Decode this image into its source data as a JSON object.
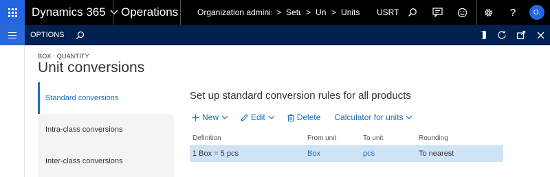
{
  "nav": {
    "app_name": "Dynamics 365",
    "workspace": "Operations",
    "breadcrumbs": [
      "Organization administ",
      "Setu",
      "Uni",
      "Units"
    ],
    "company": "USRT",
    "avatar_initials": "O."
  },
  "actionbar": {
    "options_label": "OPTIONS"
  },
  "page": {
    "caption": "BOX : QUANTITY",
    "title": "Unit conversions"
  },
  "tabs": [
    {
      "label": "Standard conversions",
      "active": true
    },
    {
      "label": "Intra-class conversions",
      "active": false
    },
    {
      "label": "Inter-class conversions",
      "active": false
    }
  ],
  "content": {
    "section_title": "Set up standard conversion rules for all products",
    "toolbar": {
      "new_label": "New",
      "edit_label": "Edit",
      "delete_label": "Delete",
      "calculator_label": "Calculator for units"
    },
    "grid": {
      "columns": [
        "Definition",
        "From unit",
        "To unit",
        "Rounding"
      ],
      "rows": [
        {
          "definition": "1 Box = 5 pcs",
          "from_unit": "Box",
          "to_unit": "pcs",
          "rounding": "To nearest"
        }
      ]
    }
  },
  "colors": {
    "nav_bg": "#000000",
    "actionbar_bg": "#002050",
    "accent": "#1a6fc2",
    "selected_row": "#cfe3f7",
    "waffle_bg": "#2266e3"
  }
}
